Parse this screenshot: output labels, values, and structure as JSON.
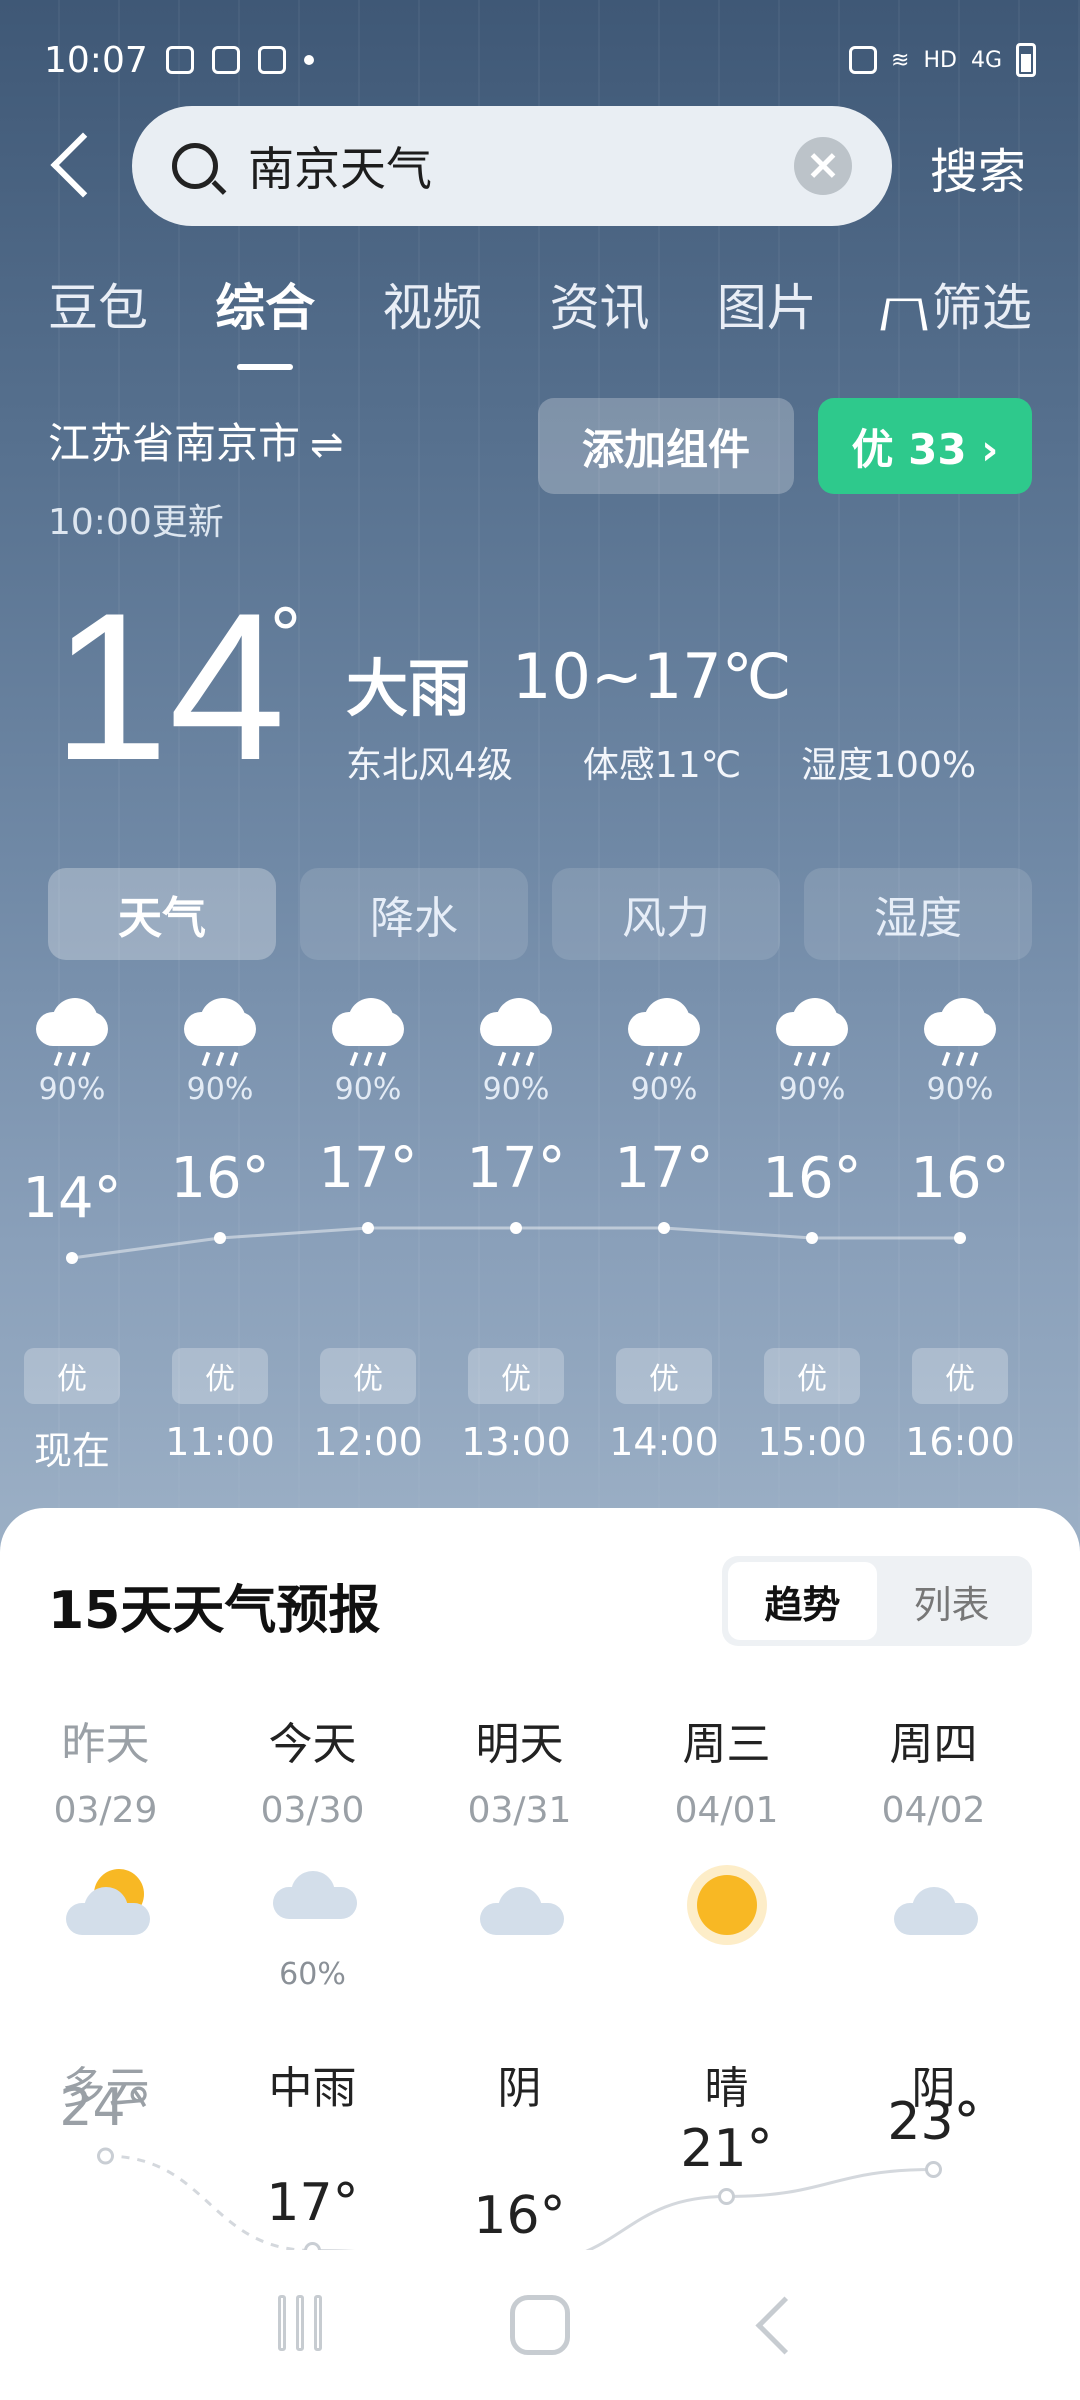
{
  "status_bar": {
    "time": "10:07",
    "network": "HD",
    "signal": "4G"
  },
  "search": {
    "query": "南京天气",
    "button": "搜索"
  },
  "tabs": [
    "豆包",
    "综合",
    "视频",
    "资讯",
    "图片",
    "筛选"
  ],
  "location": {
    "city": "江苏省南京市",
    "swap_symbol": "⇌",
    "updated": "10:00更新"
  },
  "buttons": {
    "add_widget": "添加组件",
    "aqi": "优 33 ›"
  },
  "current": {
    "temp": "14",
    "deg": "°",
    "condition": "大雨",
    "range": "10~17℃",
    "wind": "东北风4级",
    "feels": "体感11℃",
    "humidity": "湿度100%"
  },
  "chips": [
    "天气",
    "降水",
    "风力",
    "湿度"
  ],
  "hourly": [
    {
      "pct": "90%",
      "temp": "14°",
      "aqi": "优",
      "time": "现在"
    },
    {
      "pct": "90%",
      "temp": "16°",
      "aqi": "优",
      "time": "11:00"
    },
    {
      "pct": "90%",
      "temp": "17°",
      "aqi": "优",
      "time": "12:00"
    },
    {
      "pct": "90%",
      "temp": "17°",
      "aqi": "优",
      "time": "13:00"
    },
    {
      "pct": "90%",
      "temp": "17°",
      "aqi": "优",
      "time": "14:00"
    },
    {
      "pct": "90%",
      "temp": "16°",
      "aqi": "优",
      "time": "15:00"
    },
    {
      "pct": "90%",
      "temp": "16°",
      "aqi": "优",
      "time": "16:00"
    }
  ],
  "forecast": {
    "title": "15天天气预报",
    "toggle": [
      "趋势",
      "列表"
    ],
    "days": [
      {
        "name": "昨天",
        "date": "03/29",
        "icon": "partly-cloudy",
        "pop": "",
        "cond": "多云",
        "high": "24°",
        "past": true
      },
      {
        "name": "今天",
        "date": "03/30",
        "icon": "rain",
        "pop": "60%",
        "cond": "中雨",
        "high": "17°",
        "past": false
      },
      {
        "name": "明天",
        "date": "03/31",
        "icon": "cloudy",
        "pop": "",
        "cond": "阴",
        "high": "16°",
        "past": false
      },
      {
        "name": "周三",
        "date": "04/01",
        "icon": "sunny",
        "pop": "",
        "cond": "晴",
        "high": "21°",
        "past": false
      },
      {
        "name": "周四",
        "date": "04/02",
        "icon": "cloudy",
        "pop": "",
        "cond": "阴",
        "high": "23°",
        "past": false
      }
    ]
  },
  "colors": {
    "aqi_good": "#2ec98c",
    "sun": "#f8b824"
  }
}
